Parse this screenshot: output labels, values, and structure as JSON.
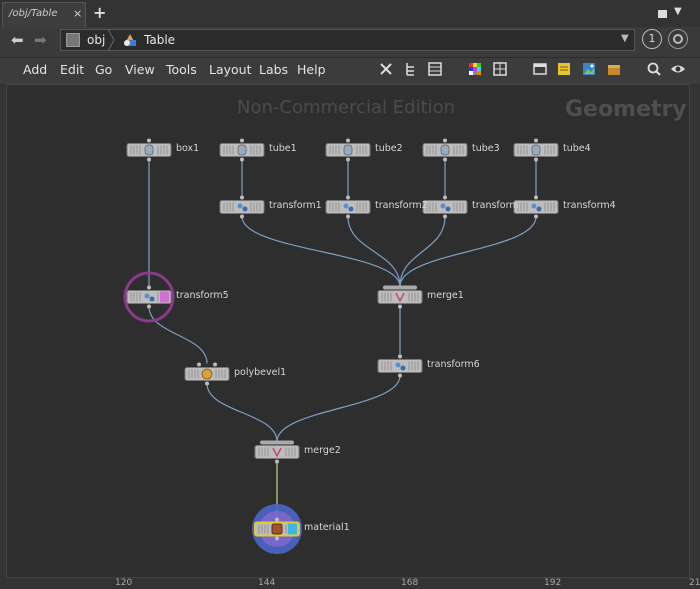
{
  "tab": {
    "label": "/obj/Table",
    "close": "×",
    "add": "+"
  },
  "pathbar": {
    "back": "⬅",
    "forward": "➡",
    "root": "obj",
    "current": "Table",
    "dropdown": "▼",
    "pin": "1"
  },
  "menu": {
    "items": [
      "Add",
      "Edit",
      "Go",
      "View",
      "Tools",
      "Layout",
      "Labs",
      "Help"
    ]
  },
  "toolbar": {
    "icons": [
      "wrench-icon",
      "tree-icon",
      "list-icon",
      "color-palette-icon",
      "grid-icon",
      "network-box-icon",
      "sticky-note-icon",
      "image-icon",
      "package-icon",
      "search-icon",
      "eye-icon"
    ]
  },
  "canvas": {
    "watermark": "Non-Commercial Edition",
    "context": "Geometry",
    "nodes": [
      {
        "id": "box1",
        "label": "box1",
        "type": "box",
        "display": false
      },
      {
        "id": "tube1",
        "label": "tube1",
        "type": "tube",
        "display": false
      },
      {
        "id": "tube2",
        "label": "tube2",
        "type": "tube",
        "display": false
      },
      {
        "id": "tube3",
        "label": "tube3",
        "type": "tube",
        "display": false
      },
      {
        "id": "tube4",
        "label": "tube4",
        "type": "tube",
        "display": false
      },
      {
        "id": "transform1",
        "label": "transform1",
        "type": "transform",
        "display": false
      },
      {
        "id": "transform2",
        "label": "transform2",
        "type": "transform",
        "display": false
      },
      {
        "id": "transform3",
        "label": "transform",
        "type": "transform",
        "display": false
      },
      {
        "id": "transform4",
        "label": "transform4",
        "type": "transform",
        "display": false
      },
      {
        "id": "transform5",
        "label": "transform5",
        "type": "transform",
        "display": false,
        "flag": "bypass"
      },
      {
        "id": "merge1",
        "label": "merge1",
        "type": "merge",
        "display": false
      },
      {
        "id": "transform6",
        "label": "transform6",
        "type": "transform",
        "display": false
      },
      {
        "id": "polybevel1",
        "label": "polybevel1",
        "type": "polybevel",
        "display": false
      },
      {
        "id": "merge2",
        "label": "merge2",
        "type": "merge",
        "display": false
      },
      {
        "id": "material1",
        "label": "material1",
        "type": "material",
        "display": true
      }
    ],
    "wires": [
      [
        "box1",
        "transform5"
      ],
      [
        "tube1",
        "transform1"
      ],
      [
        "tube2",
        "transform2"
      ],
      [
        "tube3",
        "transform3"
      ],
      [
        "tube4",
        "transform4"
      ],
      [
        "transform1",
        "merge1"
      ],
      [
        "transform2",
        "merge1"
      ],
      [
        "transform3",
        "merge1"
      ],
      [
        "transform4",
        "merge1"
      ],
      [
        "transform5",
        "polybevel1"
      ],
      [
        "merge1",
        "transform6"
      ],
      [
        "polybevel1",
        "merge2"
      ],
      [
        "transform6",
        "merge2"
      ],
      [
        "merge2",
        "material1"
      ]
    ]
  },
  "ruler": {
    "ticks": [
      "120",
      "144",
      "168",
      "192",
      "21"
    ]
  },
  "colors": {
    "wire": "#7f9fc6",
    "display_wire": "#b8d48a",
    "bypass_flag": "#d070d0",
    "display_flag": "#3fb6df",
    "highlight": "#e4c930",
    "node_body": "#bdbdbd"
  }
}
